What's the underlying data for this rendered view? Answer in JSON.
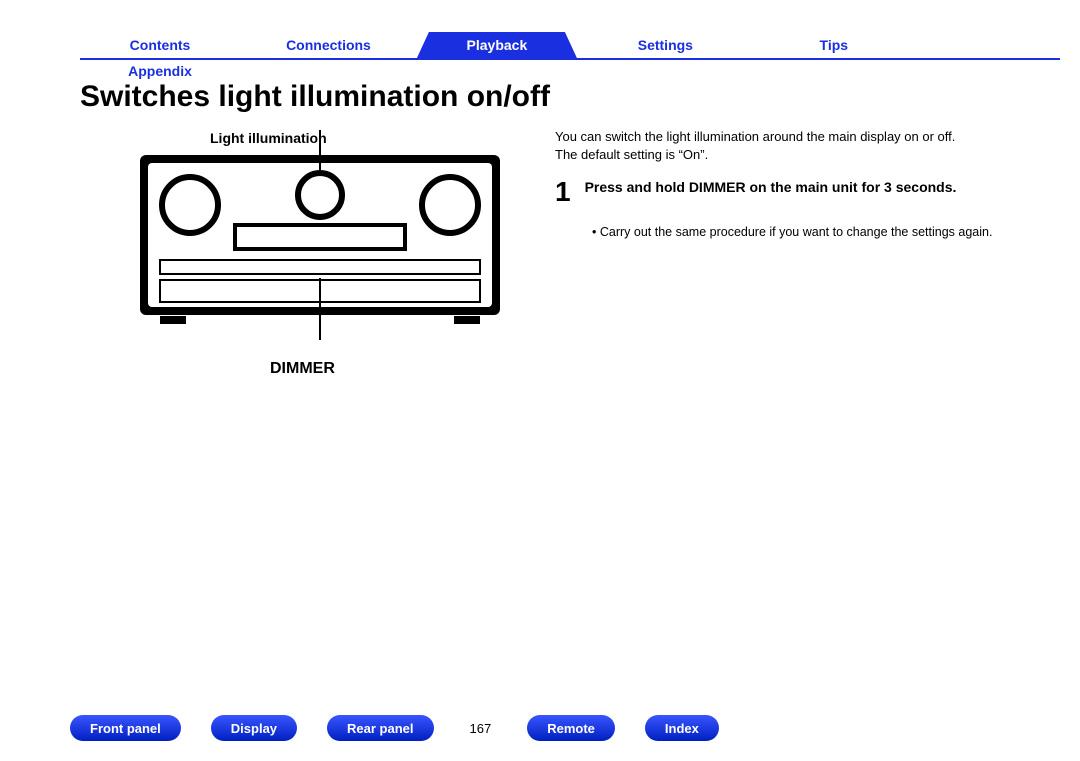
{
  "topnav": {
    "items": [
      {
        "label": "Contents",
        "active": false
      },
      {
        "label": "Connections",
        "active": false
      },
      {
        "label": "Playback",
        "active": true
      },
      {
        "label": "Settings",
        "active": false
      },
      {
        "label": "Tips",
        "active": false
      },
      {
        "label": "Appendix",
        "active": false
      }
    ]
  },
  "heading": "Switches light illumination on/off",
  "diagram": {
    "top_label": "Light illumination",
    "bottom_label": "DIMMER"
  },
  "description": "You can switch the light illumination around the main display on or off.\nThe default setting is “On”.",
  "step": {
    "number": "1",
    "instruction": "Press and hold DIMMER on the main unit for 3 seconds.",
    "bullet": "Carry out the same procedure if you want to change the settings again."
  },
  "bottomnav": {
    "page_number": "167",
    "items": [
      "Front panel",
      "Display",
      "Rear panel",
      "__PAGE__",
      "Remote",
      "Index"
    ]
  },
  "colors": {
    "brand_blue": "#1a2fe0"
  }
}
